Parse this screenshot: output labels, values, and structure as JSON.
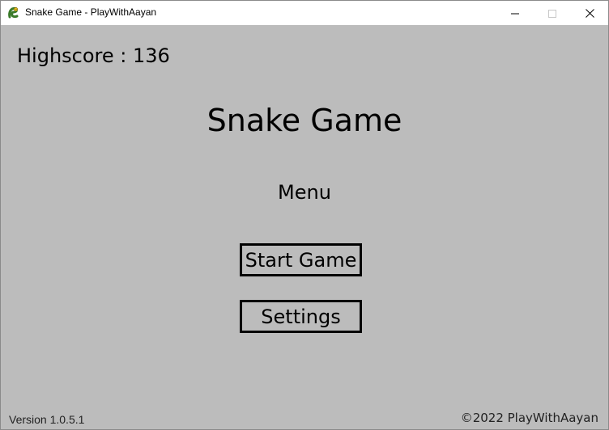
{
  "window": {
    "title": "Snake Game - PlayWithAayan",
    "app_icon": "pygame-snake-icon",
    "controls": [
      "minimize-icon",
      "maximize-icon",
      "close-icon"
    ]
  },
  "game": {
    "background_color": "#bcbcbc",
    "highscore_text": "Highscore : 136",
    "title": "Snake Game",
    "menu_label": "Menu",
    "buttons": {
      "start": "Start Game",
      "settings": "Settings"
    },
    "version": "Version 1.0.5.1",
    "copyright": "©2022 PlayWithAayan"
  }
}
